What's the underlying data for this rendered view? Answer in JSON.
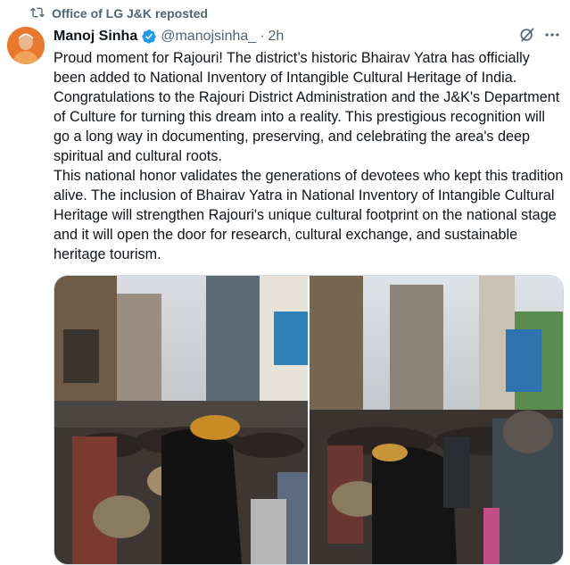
{
  "repost": {
    "icon": "repost-icon",
    "label": "Office of LG J&K reposted"
  },
  "author": {
    "name": "Manoj Sinha",
    "handle": "@manojsinha_",
    "separator": "·",
    "time": "2h",
    "verified_color": "#1d9bf0"
  },
  "tweet": {
    "paragraph_1": "Proud moment for Rajouri! The district’s historic Bhairav Yatra has officially been added to National Inventory of Intangible Cultural Heritage of India. Congratulations to the Rajouri District Administration and the J&K's Department of Culture for turning this dream into a reality. This prestigious recognition will go a long way in documenting, preserving, and celebrating the area's deep spiritual and cultural roots.",
    "paragraph_2": "This national honor validates the generations of devotees who kept this tradition alive. The inclusion of Bhairav Yatra in National Inventory of Intangible Cultural Heritage will strengthen Rajouri's unique cultural footprint on the national stage and it will open the door for research, cultural exchange, and sustainable heritage tourism."
  },
  "icons": {
    "grok": "grok-icon",
    "more": "more-icon"
  },
  "media": {
    "count": 2
  }
}
